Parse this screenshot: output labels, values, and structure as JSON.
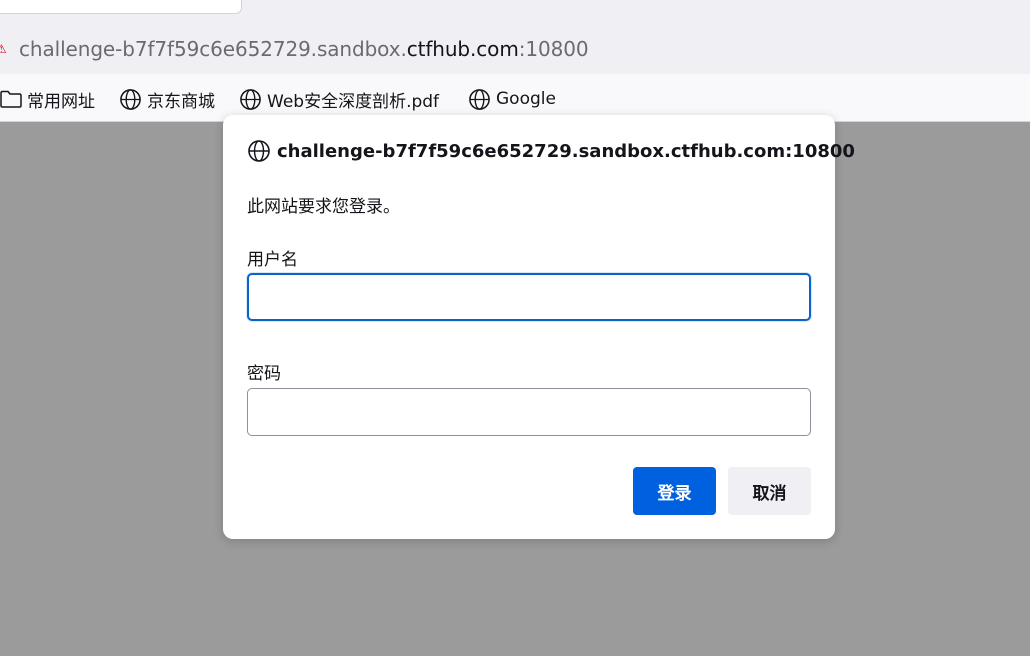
{
  "browser": {
    "url": {
      "prefix": "challenge-b7f7f59c6e652729.sandbox.",
      "domain": "ctfhub.com",
      "port": ":10800"
    },
    "bookmarks": [
      {
        "label": "常用网址",
        "icon": "folder-icon"
      },
      {
        "label": "京东商城",
        "icon": "globe-icon"
      },
      {
        "label": "Web安全深度剖析.pdf",
        "icon": "globe-icon"
      },
      {
        "label": "Google",
        "icon": "globe-icon"
      }
    ]
  },
  "dialog": {
    "host": "challenge-b7f7f59c6e652729.sandbox.ctfhub.com:10800",
    "message": "此网站要求您登录。",
    "username_label": "用户名",
    "username_value": "",
    "password_label": "密码",
    "password_value": "",
    "login_label": "登录",
    "cancel_label": "取消"
  },
  "colors": {
    "accent": "#0061e0",
    "focus_ring": "#0a63c9",
    "overlay": "#9b9b9c"
  }
}
